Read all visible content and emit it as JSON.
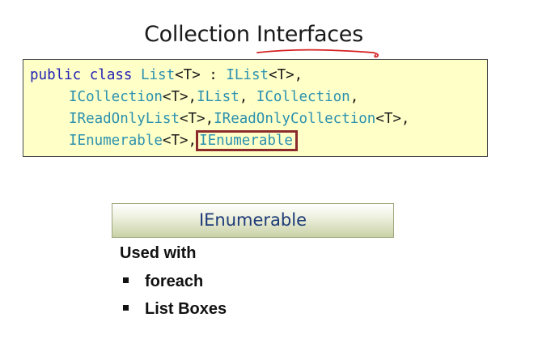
{
  "slide": {
    "title": "Collection Interfaces",
    "code": {
      "line1": {
        "kw": "public class ",
        "name": "List",
        "generic": "<T> : ",
        "type1": "IList",
        "rest": "<T>,"
      },
      "line2": {
        "t1": "ICollection",
        "g1": "<T>,",
        "t2": "IList",
        "s1": ", ",
        "t3": "ICollection",
        "end": ","
      },
      "line3": {
        "t1": "IReadOnlyList",
        "g1": "<T>,",
        "t2": "IReadOnlyCollection",
        "end": "<T>,"
      },
      "line4": {
        "t1": "IEnumerable",
        "g1": "<T>,",
        "highlighted": "IEnumerable"
      }
    },
    "section_header": "IEnumerable",
    "used_with_label": "Used with",
    "bullets": [
      "foreach",
      "List Boxes"
    ],
    "colors": {
      "keyword": "#1f1fb5",
      "type": "#2b91af",
      "code_background": "#ffffc8",
      "highlight_border": "#8b2b2b",
      "header_text": "#1d3a78",
      "ink_annotation": "#d62020"
    }
  }
}
